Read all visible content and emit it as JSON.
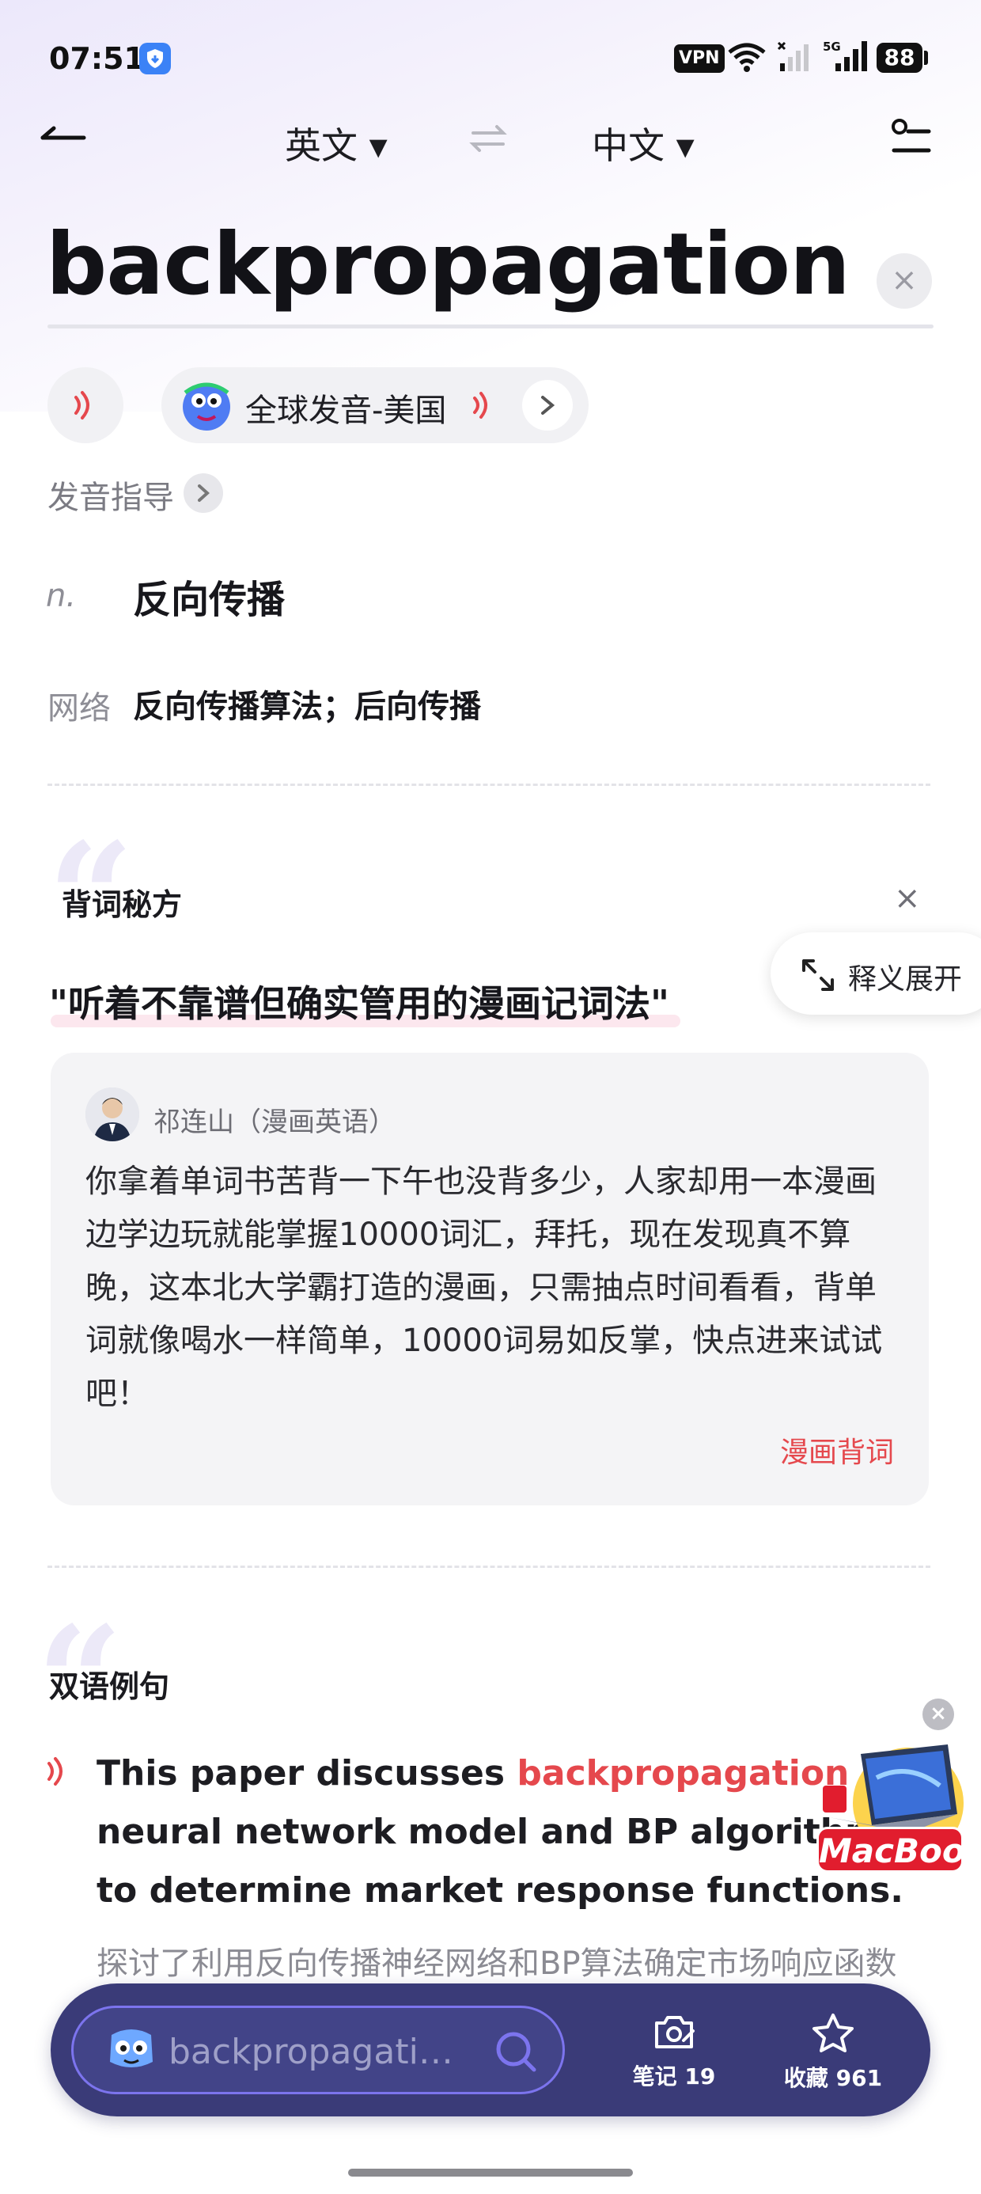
{
  "status_bar": {
    "time": "07:51",
    "vpn_label": "VPN",
    "network_label": "5G",
    "battery": "88"
  },
  "nav": {
    "source_lang": "英文 ▾",
    "target_lang": "中文 ▾",
    "swap_icon": "swap-arrows-icon",
    "back_icon": "back-arrow-icon",
    "settings_icon": "settings-sliders-icon"
  },
  "search": {
    "headword": "backpropagation",
    "clear_icon": "×"
  },
  "pronunciation": {
    "global_label": "全球发音-美国",
    "guide_label": "发音指导",
    "guide_chevron": "›"
  },
  "definitions": {
    "pos": "n.",
    "meaning": "反向传播",
    "web_tag": "网络",
    "web_meaning": "反向传播算法；后向传播"
  },
  "promo_section": {
    "quote_glyph": "“",
    "title": "背词秘方",
    "close_glyph": "×",
    "expand_label": "释义展开",
    "headline": "\"听着不靠谱但确实管用的漫画记词法\"",
    "author": "祁连山（漫画英语）",
    "body": "你拿着单词书苦背一下午也没背多少，人家却用一本漫画边学边玩就能掌握10000词汇，拜托，现在发现真不算晚，这本北大学霸打造的漫画，只需抽点时间看看，背单词就像喝水一样简单，10000词易如反掌，快点进来试试吧！",
    "link": "漫画背词"
  },
  "examples_section": {
    "quote_glyph": "“",
    "title": "双语例句",
    "en_before": "This paper discusses ",
    "en_highlight": "backpropagation",
    "en_after": " neural network model and BP algorithm to determine market response functions.",
    "zh": "探讨了利用反向传播神经网络和BP算法确定市场响应函数的方法。"
  },
  "ad": {
    "label": "MacBook",
    "close_glyph": "×"
  },
  "bottom_bar": {
    "search_value": "backpropagatio...",
    "notes_label": "笔记 19",
    "favorites_label": "收藏 961"
  },
  "colors": {
    "accent_red": "#e5484d",
    "bottom_bar": "#3a3b78",
    "search_border": "#7c74ee"
  }
}
